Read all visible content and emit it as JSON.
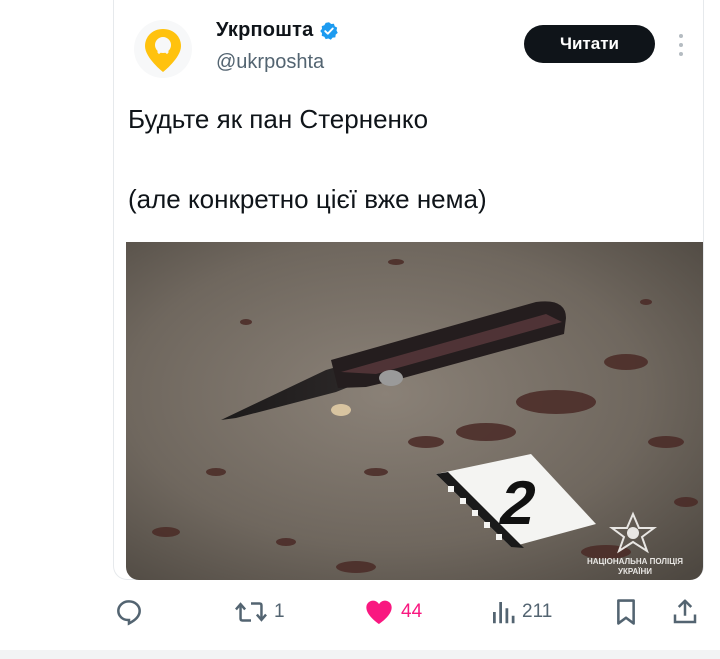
{
  "tweet": {
    "author_name": "Укрпошта",
    "author_handle": "@ukrposhta",
    "follow_label": "Читати",
    "text_line1": "Будьте як пан Стерненко",
    "text_line2": "(але конкретно цієї вже нема)"
  },
  "media": {
    "evidence_marker": "2",
    "watermark_line1": "НАЦІОНАЛЬНА ПОЛІЦІЯ",
    "watermark_line2": "УКРАЇНИ"
  },
  "actions": {
    "replies": "",
    "reposts": "1",
    "likes": "44",
    "views": "211"
  },
  "colors": {
    "accent_like": "#f91880",
    "verified": "#1d9bf0",
    "logo_yellow": "#ffc20e"
  }
}
